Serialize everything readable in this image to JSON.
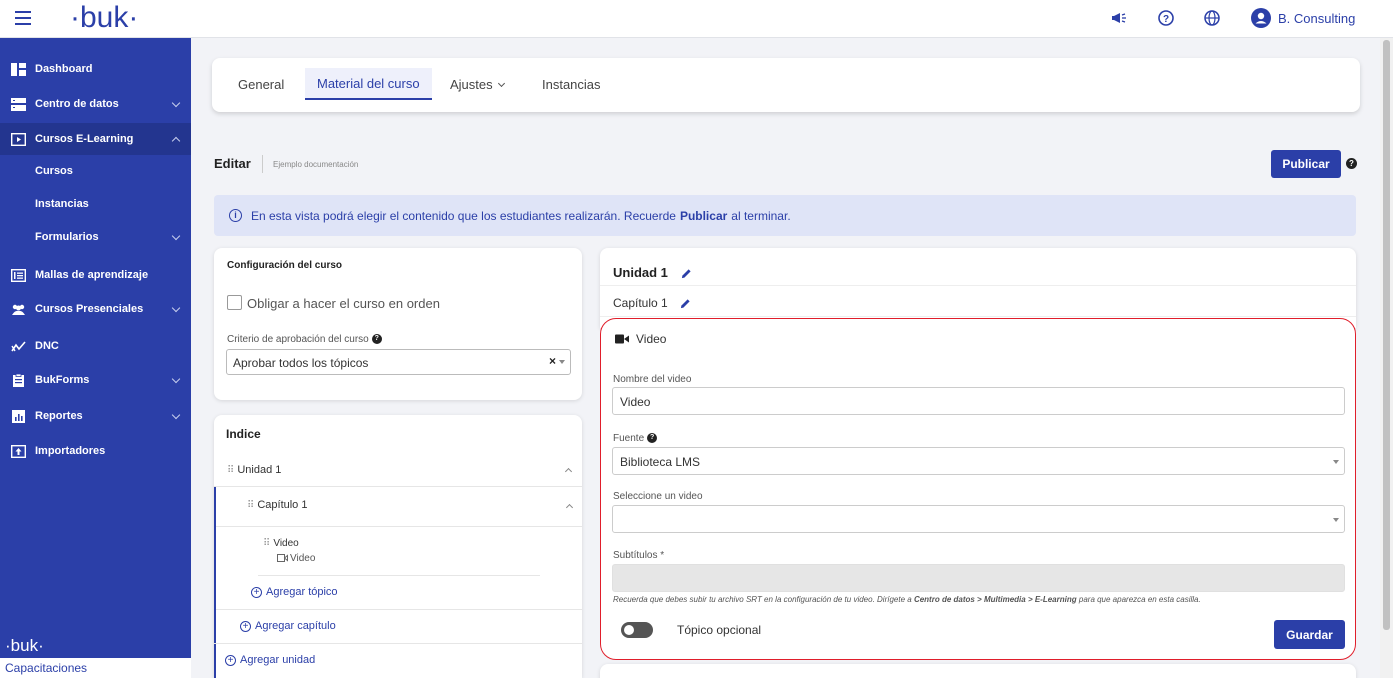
{
  "header": {
    "logo": "·buk·",
    "user_name": "B. Consulting"
  },
  "sidebar": {
    "items": [
      {
        "label": "Dashboard"
      },
      {
        "label": "Centro de datos"
      },
      {
        "label": "Cursos E-Learning"
      },
      {
        "label": "Mallas de aprendizaje"
      },
      {
        "label": "Cursos Presenciales"
      },
      {
        "label": "DNC"
      },
      {
        "label": "BukForms"
      },
      {
        "label": "Reportes"
      },
      {
        "label": "Importadores"
      }
    ],
    "subitems": [
      {
        "label": "Cursos"
      },
      {
        "label": "Instancias"
      },
      {
        "label": "Formularios"
      }
    ],
    "footer_logo": "·buk·",
    "footer_label": "Capacitaciones"
  },
  "tabs": [
    {
      "label": "General"
    },
    {
      "label": "Material del curso"
    },
    {
      "label": "Ajustes"
    },
    {
      "label": "Instancias"
    }
  ],
  "page": {
    "edit_title": "Editar",
    "edit_subtitle": "Ejemplo documentación",
    "publish_label": "Publicar",
    "info_pre": "En esta vista podrá elegir el contenido que los estudiantes realizarán. Recuerde",
    "info_bold": "Publicar",
    "info_post": "al terminar."
  },
  "config": {
    "title": "Configuración del curso",
    "checkbox_label": "Obligar a hacer el curso en orden",
    "criterion_label": "Criterio de aprobación del curso",
    "criterion_value": "Aprobar todos los tópicos"
  },
  "index": {
    "title": "Indice",
    "unit": "Unidad 1",
    "chapter": "Capítulo 1",
    "topic": "Video",
    "topic_type": "Video",
    "add_topic": "Agregar tópico",
    "add_chapter": "Agregar capítulo",
    "add_unit": "Agregar unidad"
  },
  "editor": {
    "unit_title": "Unidad 1",
    "chapter_title": "Capítulo 1",
    "block_type": "Video",
    "name_label": "Nombre del video",
    "name_value": "Video",
    "source_label": "Fuente",
    "source_value": "Biblioteca LMS",
    "select_label": "Seleccione un video",
    "select_value": "",
    "subtitles_label": "Subtítulos *",
    "note_pre": "Recuerda que debes subir tu archivo SRT en la configuración de tu video. Dirígete a",
    "note_bold": "Centro de datos > Multimedia > E-Learning",
    "note_post": "para que aparezca en esta casilla.",
    "optional_label": "Tópico opcional",
    "optional_on": false,
    "save_label": "Guardar"
  },
  "colors": {
    "primary": "#2b3fa8",
    "highlight_border": "#e01e2b",
    "info_bg": "#dfe4f7"
  }
}
